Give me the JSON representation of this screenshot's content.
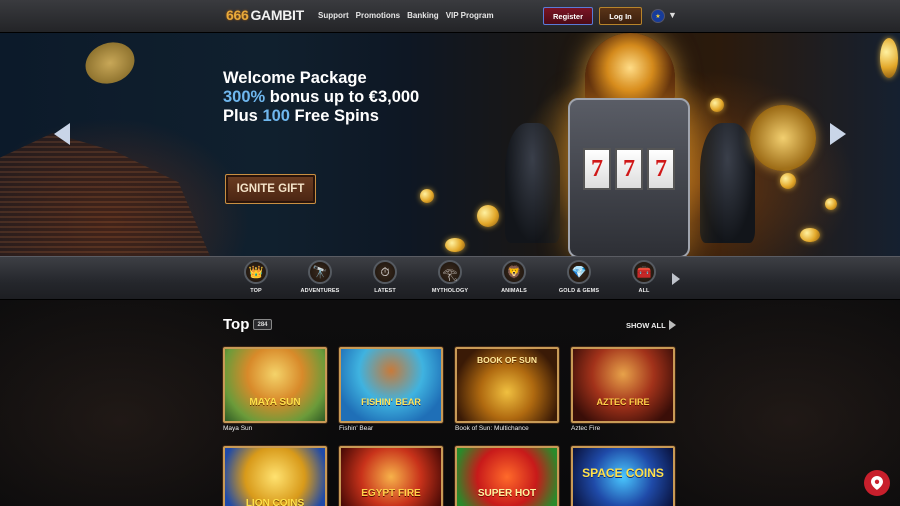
{
  "header": {
    "logo_number": "666",
    "logo_text": "GAMBIT",
    "nav": [
      "Support",
      "Promotions",
      "Banking",
      "VIP Program"
    ],
    "register_label": "Register",
    "login_label": "Log In",
    "language_icon": "eu-flag-icon"
  },
  "hero": {
    "line1": "Welcome Package",
    "line2_highlight": "300%",
    "line2_rest": " bonus up to €3,000",
    "line3_start": "Plus ",
    "line3_highlight": "100",
    "line3_rest": " Free Spins",
    "cta_label": "IGNITE GIFT",
    "slot_symbols": [
      "7",
      "7",
      "7"
    ],
    "accent_color": "#6fb7ee"
  },
  "categories": [
    {
      "label": "TOP",
      "icon": "crown-icon"
    },
    {
      "label": "ADVENTURES",
      "icon": "spyglass-icon"
    },
    {
      "label": "LATEST",
      "icon": "stopwatch-icon"
    },
    {
      "label": "MYTHOLOGY",
      "icon": "pharaoh-icon"
    },
    {
      "label": "ANIMALS",
      "icon": "lion-icon"
    },
    {
      "label": "GOLD & GEMS",
      "icon": "gems-icon"
    },
    {
      "label": "ALL",
      "icon": "chest-icon"
    }
  ],
  "top_section": {
    "title": "Top",
    "count": "284",
    "show_all_label": "SHOW ALL"
  },
  "games": [
    {
      "name": "Maya Sun",
      "art_title": "MAYA SUN"
    },
    {
      "name": "Fishin' Bear",
      "art_title": "FISHIN' BEAR"
    },
    {
      "name": "Book of Sun: Multichance",
      "art_title": "BOOK OF SUN"
    },
    {
      "name": "Aztec Fire",
      "art_title": "AZTEC FIRE"
    },
    {
      "name": "",
      "art_title": "LION COINS"
    },
    {
      "name": "",
      "art_title": "EGYPT FIRE"
    },
    {
      "name": "",
      "art_title": "SUPER HOT"
    },
    {
      "name": "",
      "art_title": "SPACE COINS"
    }
  ]
}
